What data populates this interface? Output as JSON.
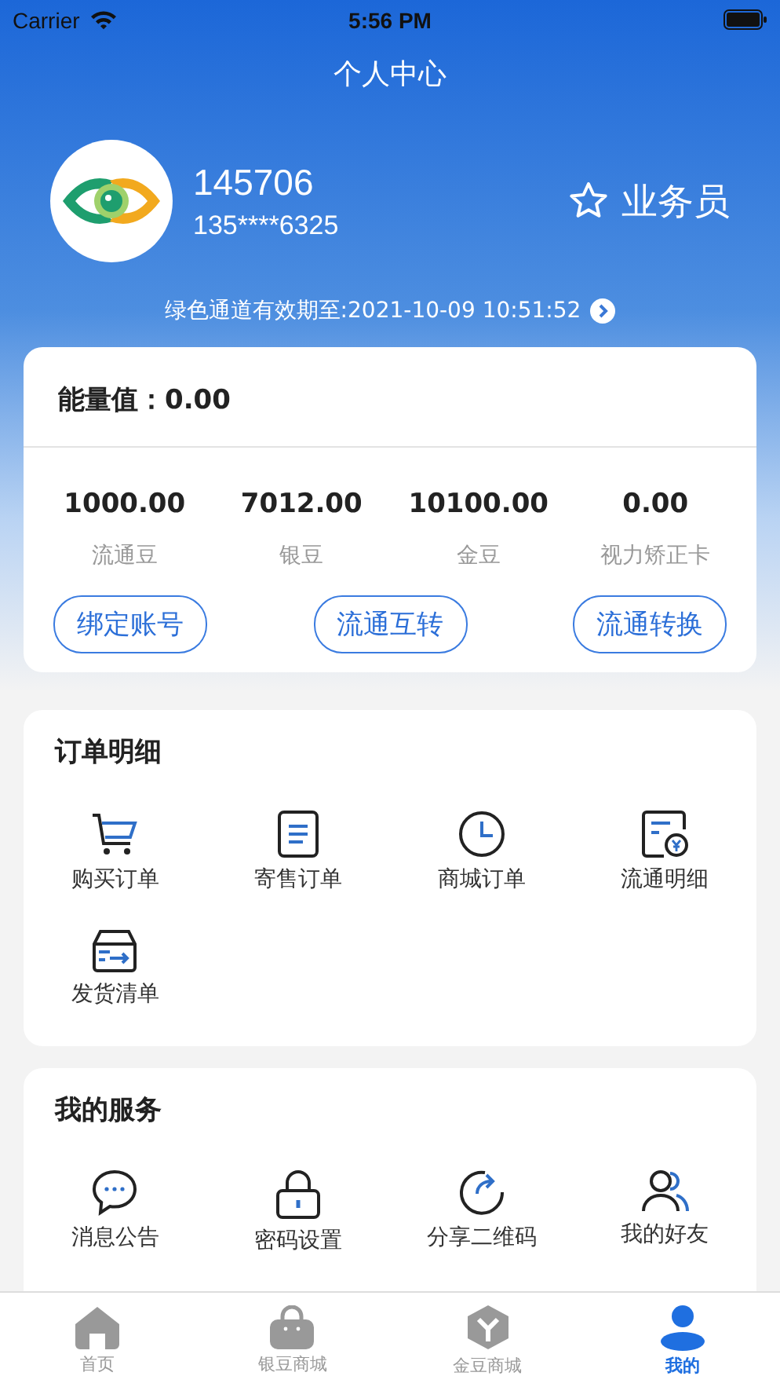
{
  "status_bar": {
    "carrier": "Carrier",
    "time": "5:56 PM"
  },
  "header": {
    "title": "个人中心"
  },
  "profile": {
    "user_id": "145706",
    "phone": "135****6325",
    "role": "业务员",
    "green_channel": "绿色通道有效期至:2021-10-09 10:51:52"
  },
  "assets": {
    "energy_label": "能量值：",
    "energy_value": "0.00",
    "balances": [
      {
        "value": "1000.00",
        "label": "流通豆"
      },
      {
        "value": "7012.00",
        "label": "银豆"
      },
      {
        "value": "10100.00",
        "label": "金豆"
      },
      {
        "value": "0.00",
        "label": "视力矫正卡"
      }
    ],
    "buttons": [
      "绑定账号",
      "流通互转",
      "流通转换"
    ]
  },
  "orders": {
    "title": "订单明细",
    "items": [
      {
        "label": "购买订单",
        "kind": "cart"
      },
      {
        "label": "寄售订单",
        "kind": "document"
      },
      {
        "label": "商城订单",
        "kind": "clock"
      },
      {
        "label": "流通明细",
        "kind": "ledger"
      },
      {
        "label": "发货清单",
        "kind": "box"
      }
    ]
  },
  "services": {
    "title": "我的服务",
    "items": [
      {
        "label": "消息公告",
        "kind": "chat"
      },
      {
        "label": "密码设置",
        "kind": "lock"
      },
      {
        "label": "分享二维码",
        "kind": "share"
      },
      {
        "label": "我的好友",
        "kind": "friends"
      }
    ]
  },
  "tab_bar": [
    {
      "label": "首页",
      "kind": "home",
      "selected": false
    },
    {
      "label": "银豆商城",
      "kind": "bag",
      "selected": false
    },
    {
      "label": "金豆商城",
      "kind": "cube",
      "selected": false
    },
    {
      "label": "我的",
      "kind": "person",
      "selected": true
    }
  ]
}
